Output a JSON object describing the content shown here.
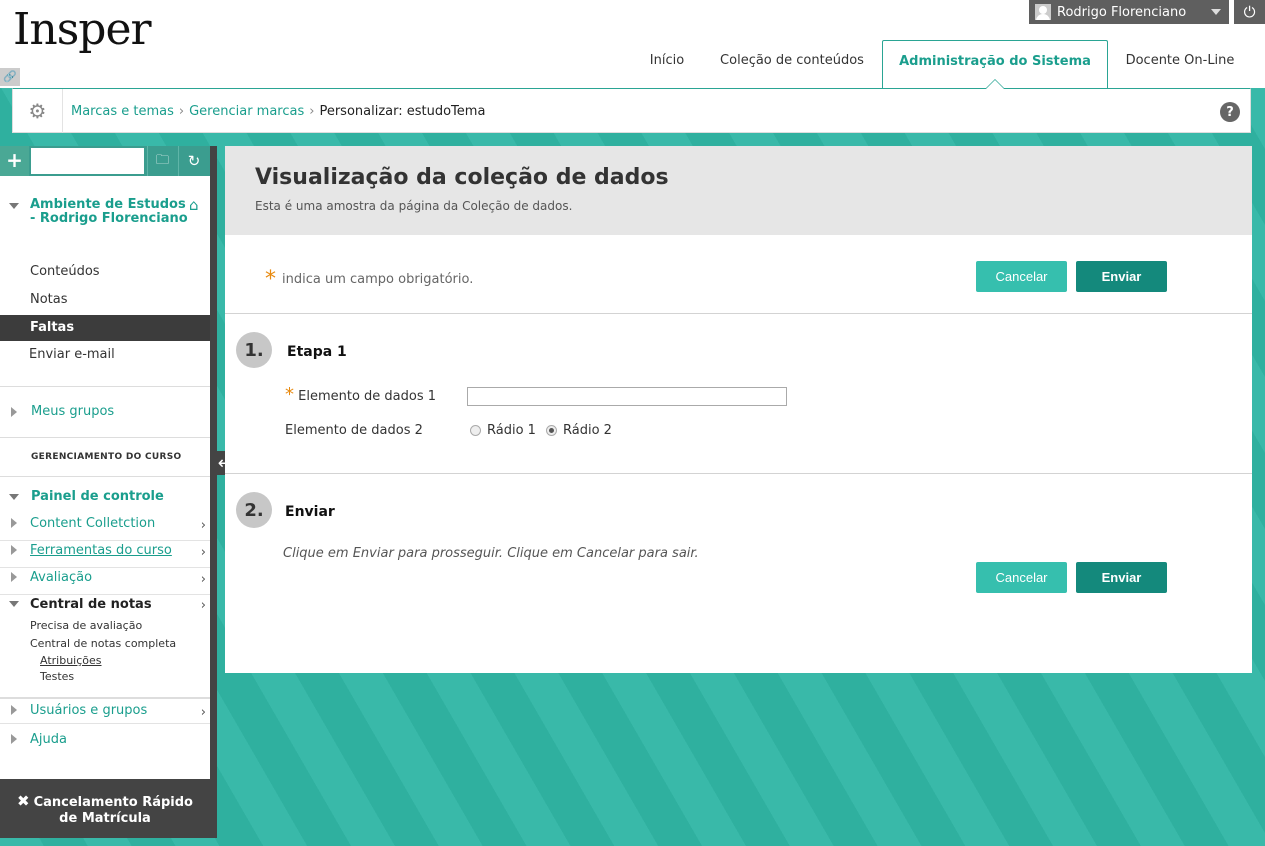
{
  "header": {
    "logo": "Insper",
    "user_name": "Rodrigo Florenciano",
    "tabs": [
      "Início",
      "Coleção de conteúdos",
      "Administração do Sistema",
      "Docente On-Line"
    ]
  },
  "breadcrumb": {
    "items": [
      "Marcas e temas",
      "Gerenciar marcas"
    ],
    "current": "Personalizar: estudoTema",
    "help_label": "?"
  },
  "sidebar": {
    "course_title": "Ambiente de Estudos - Rodrigo Florenciano",
    "menu": [
      "Conteúdos",
      "Notas",
      "Faltas",
      "Enviar e-mail"
    ],
    "groups_label": "Meus grupos",
    "management_heading": "GERENCIAMENTO DO CURSO",
    "control_panel": "Painel de controle",
    "cp_items": [
      "Content Colletction",
      "Ferramentas do curso",
      "Avaliação",
      "Central de notas"
    ],
    "grade_sub": [
      "Precisa de avaliação",
      "Central de notas completa"
    ],
    "grade_subsub": [
      "Atribuições",
      "Testes"
    ],
    "bottom_items": [
      "Usuários e grupos",
      "Ajuda"
    ],
    "quick_unenroll": [
      "Cancelamento Rápido",
      "de Matrícula"
    ]
  },
  "main": {
    "title": "Visualização da coleção de dados",
    "subtitle": "Esta é uma amostra da página da Coleção de dados.",
    "required_note": "indica um campo obrigatório.",
    "cancel_label": "Cancelar",
    "submit_label": "Enviar",
    "step1": {
      "number": "1.",
      "title": "Etapa 1",
      "field1_label": "Elemento de dados 1",
      "field2_label": "Elemento de dados 2",
      "radio1": "Rádio 1",
      "radio2": "Rádio 2"
    },
    "step2": {
      "number": "2.",
      "title": "Enviar",
      "instructions": "Clique em Enviar para prosseguir. Clique em Cancelar para sair."
    }
  },
  "colors": {
    "accent": "#1a9e8d",
    "button_primary": "#14897c",
    "button_secondary": "#36bfae",
    "required_star": "#e88a10"
  }
}
